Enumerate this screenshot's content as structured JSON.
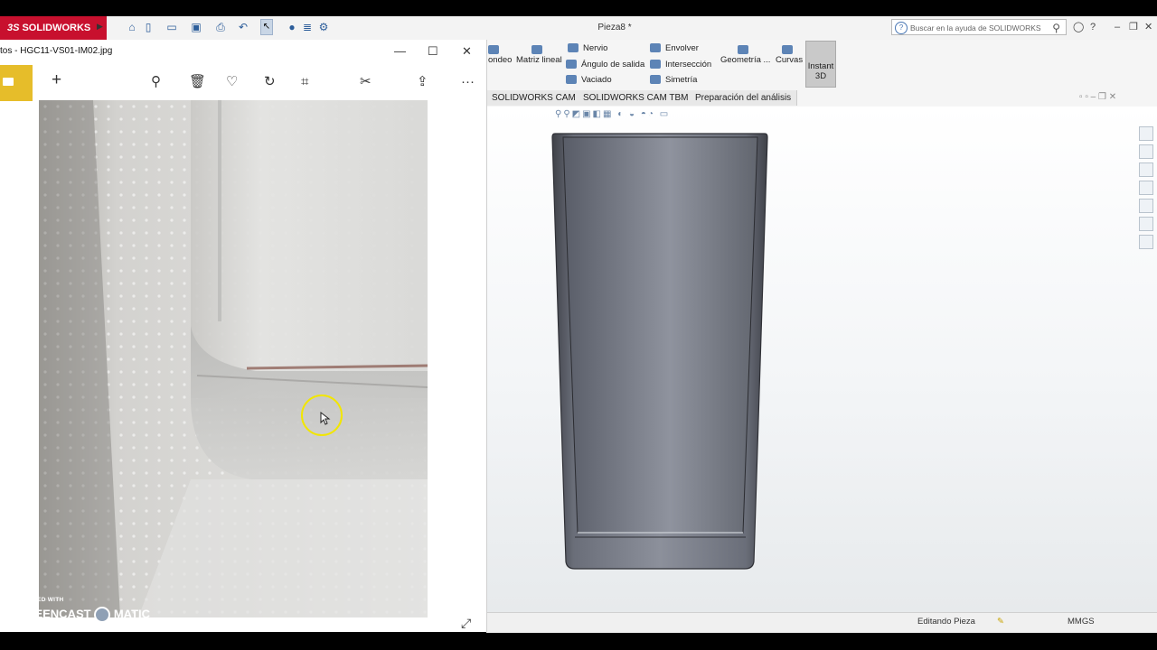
{
  "solidworks": {
    "brand": "SOLIDWORKS",
    "brand_prefix": "3S",
    "document_title": "Pieza8 *",
    "search_placeholder": "Buscar en la ayuda de SOLIDWORKS",
    "window_buttons": {
      "minimize": "–",
      "restore": "❐",
      "close": "✕"
    },
    "ribbon": {
      "redondeo": "ondeo",
      "matriz_lineal": "Matriz lineal",
      "nervio": "Nervio",
      "angulo_salida": "Ángulo de salida",
      "vaciado": "Vaciado",
      "envolver": "Envolver",
      "interseccion": "Intersección",
      "simetria": "Simetría",
      "geometria": "Geometría ...",
      "curvas": "Curvas",
      "instant3d_line1": "Instant",
      "instant3d_line2": "3D"
    },
    "tabs": [
      "SOLIDWORKS CAM",
      "SOLIDWORKS CAM TBM",
      "Preparación del análisis"
    ],
    "status_left": "Editando Pieza",
    "status_right": "MMGS"
  },
  "photos": {
    "title": "tos - HGC11-VS01-IM02.jpg",
    "window_buttons": {
      "minimize": "—",
      "maximize": "☐",
      "close": "✕"
    },
    "toolbar": {
      "add": "+",
      "more": "···"
    }
  },
  "watermark": {
    "line1": "RECORDED WITH",
    "line2": "SCREENCAST",
    "line3": "MATIC"
  },
  "colors": {
    "solidworks_red": "#c8102e",
    "photos_accent": "#e6bd2a",
    "cursor_highlight": "#f2e600",
    "model_gray": "#70747e"
  }
}
